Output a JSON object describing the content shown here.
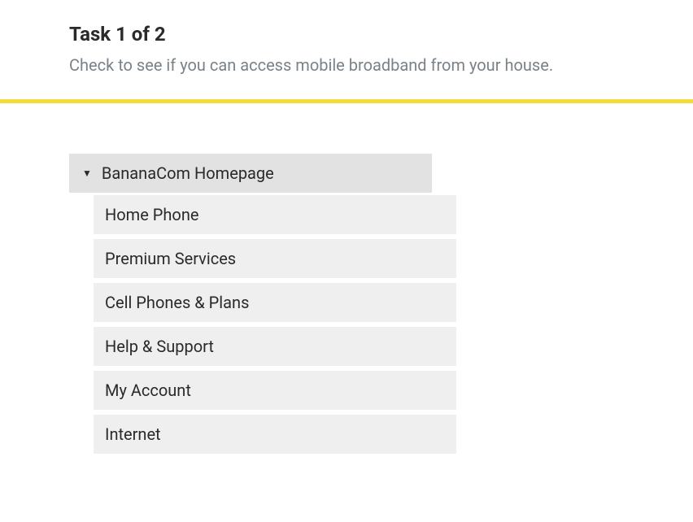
{
  "task": {
    "title": "Task 1 of 2",
    "description": "Check to see if you can access mobile broadband from your house."
  },
  "tree": {
    "root": {
      "label": "BananaCom Homepage"
    },
    "children": [
      {
        "label": "Home Phone"
      },
      {
        "label": "Premium Services"
      },
      {
        "label": "Cell Phones & Plans"
      },
      {
        "label": "Help & Support"
      },
      {
        "label": "My Account"
      },
      {
        "label": "Internet"
      }
    ]
  }
}
